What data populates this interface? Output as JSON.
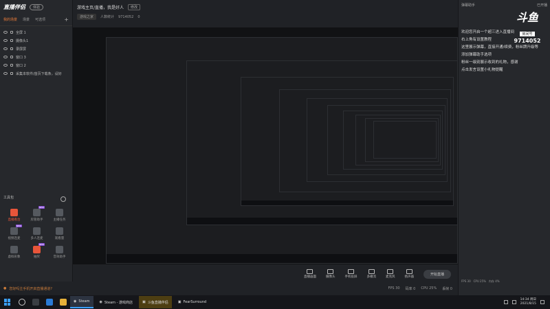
{
  "app": {
    "name": "直播伴侣",
    "badge": "体验"
  },
  "scene_tabs": {
    "items": [
      "我的场景",
      "场景",
      "可选项"
    ]
  },
  "sources": [
    {
      "label": "全屏 1"
    },
    {
      "label": "摄像头1"
    },
    {
      "label": "录屏屏"
    },
    {
      "label": "窗口 3"
    },
    {
      "label": "窗口 2"
    },
    {
      "label": "采集本软件/首页下载条，设好"
    }
  ],
  "tools": {
    "title": "工具包",
    "items": [
      {
        "label": "直播看台",
        "hot": true
      },
      {
        "label": "房管助手",
        "hot": false,
        "new": "NEW"
      },
      {
        "label": "主播任务",
        "hot": false
      },
      {
        "label": "视频连麦",
        "hot": false,
        "new": "NEW"
      },
      {
        "label": "多人连麦",
        "hot": false
      },
      {
        "label": "观看量",
        "hot": false
      },
      {
        "label": "虚拟形象",
        "hot": false
      },
      {
        "label": "抽奖",
        "hot": true,
        "new": "NEW"
      },
      {
        "label": "音效助手",
        "hot": false
      }
    ]
  },
  "room": {
    "title": "游戏主页/直播，我是好人",
    "tag": "修改",
    "category": "游戏之家",
    "meta1": "人数统计",
    "room_no": "9714052",
    "heat": "0"
  },
  "controls": [
    {
      "label": "直播画面"
    },
    {
      "label": "摄像头"
    },
    {
      "label": "手机投屏"
    },
    {
      "label": "多播流"
    },
    {
      "label": "麦克风"
    },
    {
      "label": "扬声器"
    }
  ],
  "start_button": "开始直播",
  "chat": {
    "header": "弹幕助手",
    "header_right": "已开播",
    "brand": {
      "name": "斗鱼",
      "label": "房间号",
      "room": "9714052"
    },
    "messages": [
      "欢迎您开启一个超三进入直播间",
      "右上角有设置教程",
      "这里展示弹幕，直接开通/续费，粉丝牌升级等",
      "添加弹幕助手选项",
      "粉丝一级别展示收到的礼物，感谢",
      "点击发言设置小礼物提醒"
    ]
  },
  "perf": {
    "fps": "FPS 30",
    "cpu": "CPU 25%",
    "mem": "内存 4%"
  },
  "status": {
    "notice": "您好吗主手机开启直播通道?",
    "fps": "FPS 30",
    "bitrate": "码率 0",
    "cpu": "CPU 25%",
    "lost": "丢帧 0"
  },
  "taskbar": {
    "tasks": [
      {
        "label": "Steam",
        "active": true,
        "warn": false
      },
      {
        "label": "Steam - 游戏商店",
        "active": false,
        "warn": false
      },
      {
        "label": "斗鱼直播伴侣",
        "active": false,
        "warn": true
      },
      {
        "label": "FearSurround",
        "active": false,
        "warn": false
      }
    ],
    "time": "14:34 周日",
    "date": "2021/8/15"
  },
  "colors": {
    "accent": "#e87b3a",
    "hot": "#e8553a",
    "new_badge": "#8a4fd8",
    "windows_blue": "#3ba0ff"
  }
}
